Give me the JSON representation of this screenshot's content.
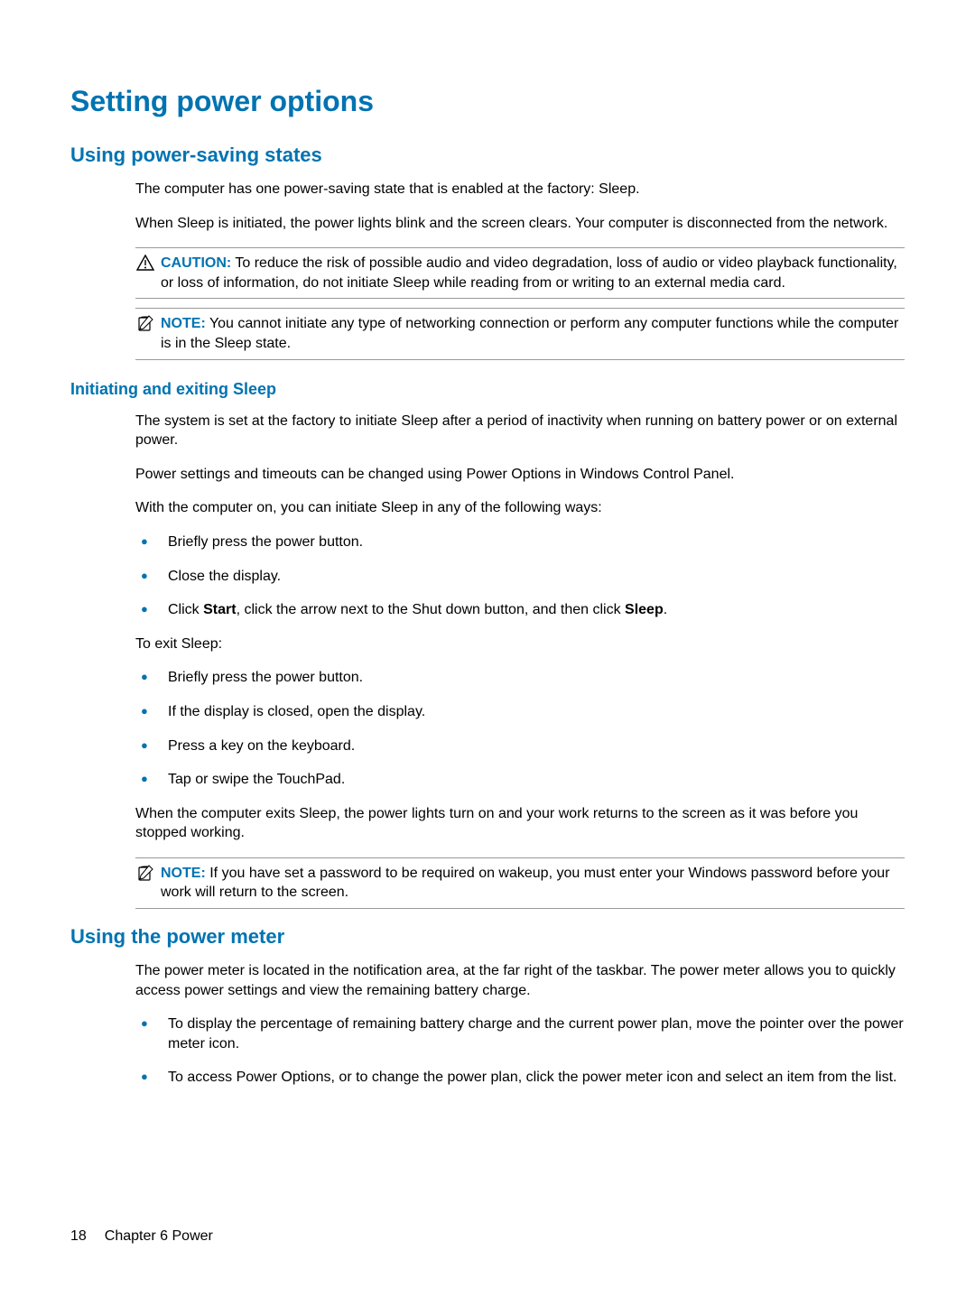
{
  "h1": "Setting power options",
  "section1": {
    "h2": "Using power-saving states",
    "p1": "The computer has one power-saving state that is enabled at the factory: Sleep.",
    "p2": "When Sleep is initiated, the power lights blink and the screen clears. Your computer is disconnected from the network.",
    "caution": {
      "label": "CAUTION:",
      "text": "To reduce the risk of possible audio and video degradation, loss of audio or video playback functionality, or loss of information, do not initiate Sleep while reading from or writing to an external media card."
    },
    "note": {
      "label": "NOTE:",
      "text": "You cannot initiate any type of networking connection or perform any computer functions while the computer is in the Sleep state."
    },
    "sub": {
      "h3": "Initiating and exiting Sleep",
      "p1": "The system is set at the factory to initiate Sleep after a period of inactivity when running on battery power or on external power.",
      "p2": "Power settings and timeouts can be changed using Power Options in Windows Control Panel.",
      "p3": "With the computer on, you can initiate Sleep in any of the following ways:",
      "list1": {
        "i0": "Briefly press the power button.",
        "i1": "Close the display.",
        "i2_pre": "Click ",
        "i2_b1": "Start",
        "i2_mid": ", click the arrow next to the Shut down button, and then click ",
        "i2_b2": "Sleep",
        "i2_post": "."
      },
      "p4": "To exit Sleep:",
      "list2": {
        "i0": "Briefly press the power button.",
        "i1": "If the display is closed, open the display.",
        "i2": "Press a key on the keyboard.",
        "i3": "Tap or swipe the TouchPad."
      },
      "p5": "When the computer exits Sleep, the power lights turn on and your work returns to the screen as it was before you stopped working.",
      "note2": {
        "label": "NOTE:",
        "text": "If you have set a password to be required on wakeup, you must enter your Windows password before your work will return to the screen."
      }
    }
  },
  "section2": {
    "h2": "Using the power meter",
    "p1": "The power meter is located in the notification area, at the far right of the taskbar. The power meter allows you to quickly access power settings and view the remaining battery charge.",
    "list": {
      "i0": "To display the percentage of remaining battery charge and the current power plan, move the pointer over the power meter icon.",
      "i1": "To access Power Options, or to change the power plan, click the power meter icon and select an item from the list."
    }
  },
  "footer": {
    "pagenum": "18",
    "chapter": "Chapter 6   Power"
  }
}
